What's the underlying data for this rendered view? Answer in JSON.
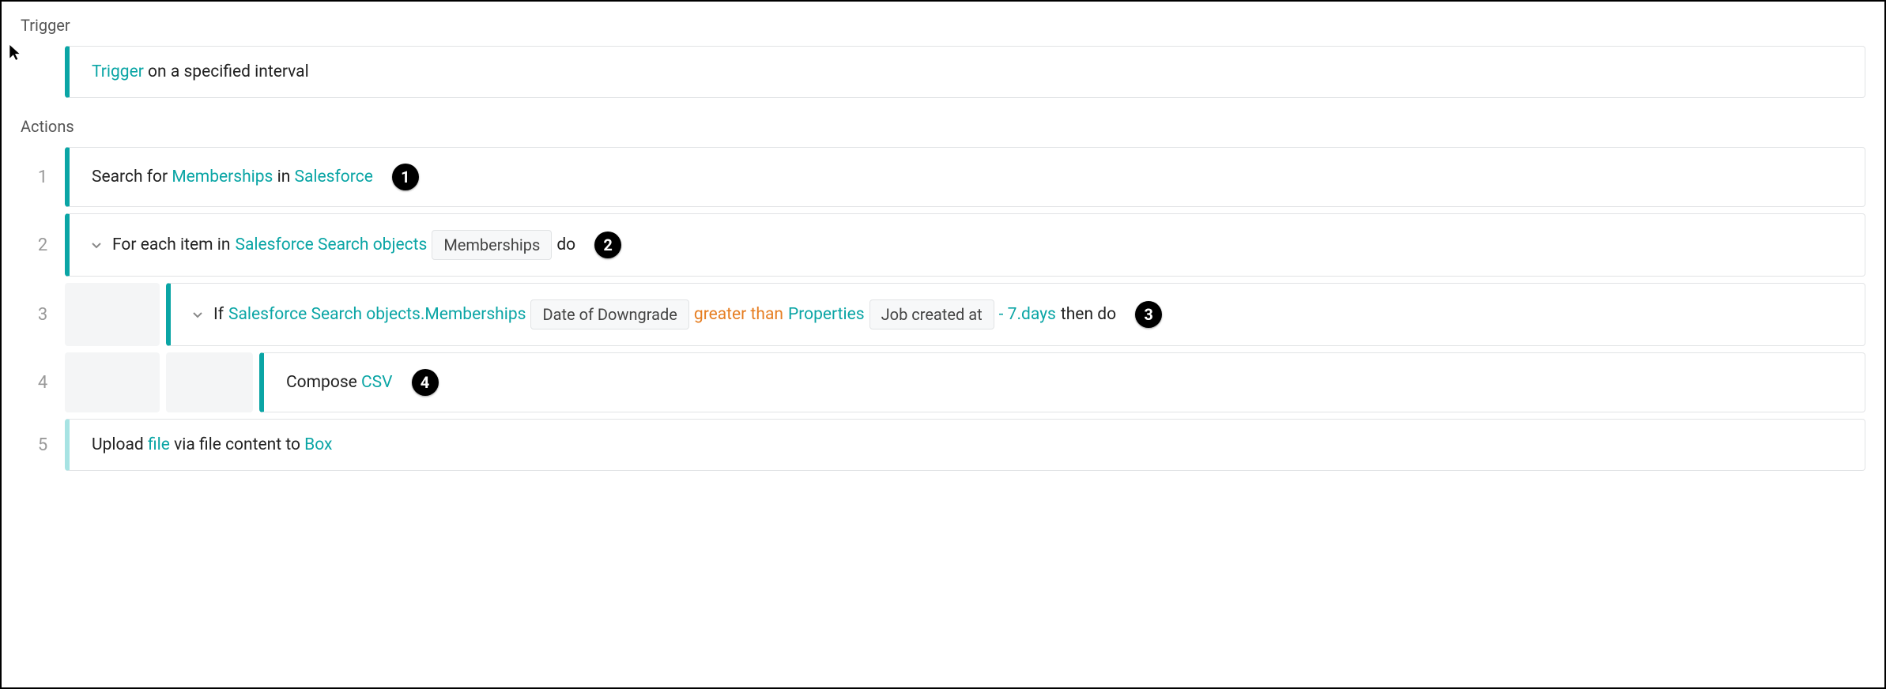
{
  "labels": {
    "trigger": "Trigger",
    "actions": "Actions"
  },
  "trigger": {
    "linkword": "Trigger",
    "rest": " on a specified interval"
  },
  "steps": [
    {
      "num": "1",
      "annot": "1",
      "text": {
        "prefix": "Search for ",
        "link1": "Memberships",
        "mid": " in ",
        "link2": "Salesforce"
      }
    },
    {
      "num": "2",
      "annot": "2",
      "text": {
        "prefix": "For each item in ",
        "link1": "Salesforce Search objects",
        "pill1": "Memberships",
        "suffix": " do"
      }
    },
    {
      "num": "3",
      "annot": "3",
      "text": {
        "prefix": "If ",
        "link1": "Salesforce Search objects.Memberships",
        "pill1": "Date of Downgrade",
        "op": "greater than",
        "link2": "Properties",
        "pill2": "Job created at",
        "offset": "- 7.days",
        "suffix": " then do"
      }
    },
    {
      "num": "4",
      "annot": "4",
      "text": {
        "prefix": "Compose ",
        "link1": "CSV"
      }
    },
    {
      "num": "5",
      "text": {
        "prefix": "Upload ",
        "link1": "file",
        "mid": " via file content to ",
        "link2": "Box"
      }
    }
  ]
}
